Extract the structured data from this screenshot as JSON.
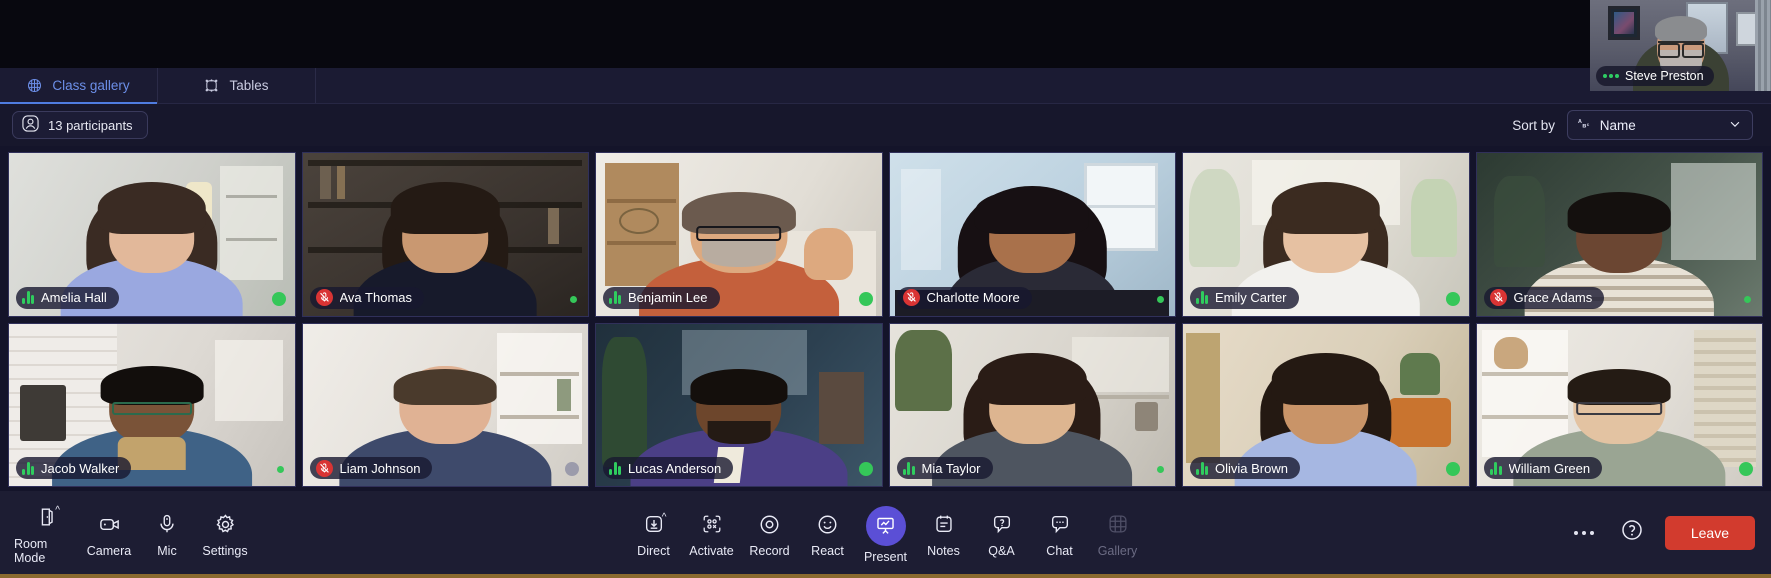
{
  "self_view": {
    "name": "Steve Preston",
    "indicator": "speaking-dots-icon",
    "indicator_color": "#2ecc63"
  },
  "tabs": [
    {
      "id": "class-gallery",
      "label": "Class gallery",
      "icon": "grid-globe-icon",
      "active": true
    },
    {
      "id": "tables",
      "label": "Tables",
      "icon": "table-seats-icon",
      "active": false
    }
  ],
  "header": {
    "participants_label": "13 participants",
    "participants_icon": "person-circle-icon",
    "sort_label": "Sort by",
    "sort_value": "Name",
    "sort_icon": "abc-sort-icon",
    "sort_chevron": "chevron-down-icon"
  },
  "colors": {
    "accent_blue": "#4f7ce0",
    "present_purple": "#5b4fd6",
    "leave_red": "#d23b2e",
    "mic_on_green": "#2fcc5e",
    "mic_off_red": "#d93434",
    "status_green": "#35c759",
    "status_grey": "#9b9bab"
  },
  "participants": [
    {
      "name": "Amelia Hall",
      "muted": false,
      "status": "green",
      "status_size": "large"
    },
    {
      "name": "Ava Thomas",
      "muted": true,
      "status": "green",
      "status_size": "small"
    },
    {
      "name": "Benjamin Lee",
      "muted": false,
      "status": "green",
      "status_size": "large"
    },
    {
      "name": "Charlotte Moore",
      "muted": true,
      "status": "green",
      "status_size": "small"
    },
    {
      "name": "Emily Carter",
      "muted": false,
      "status": "green",
      "status_size": "large"
    },
    {
      "name": "Grace Adams",
      "muted": true,
      "status": "green",
      "status_size": "small"
    },
    {
      "name": "Jacob Walker",
      "muted": false,
      "status": "green",
      "status_size": "small"
    },
    {
      "name": "Liam Johnson",
      "muted": true,
      "status": "grey",
      "status_size": "large"
    },
    {
      "name": "Lucas Anderson",
      "muted": false,
      "status": "green",
      "status_size": "large"
    },
    {
      "name": "Mia Taylor",
      "muted": false,
      "status": "green",
      "status_size": "small"
    },
    {
      "name": "Olivia Brown",
      "muted": false,
      "status": "green",
      "status_size": "large"
    },
    {
      "name": "William Green",
      "muted": false,
      "status": "green",
      "status_size": "large"
    }
  ],
  "toolbar": {
    "left": [
      {
        "id": "room-mode",
        "label": "Room Mode",
        "icon": "door-icon",
        "caret": "^"
      },
      {
        "id": "camera",
        "label": "Camera",
        "icon": "camera-icon",
        "caret": ""
      },
      {
        "id": "mic",
        "label": "Mic",
        "icon": "mic-icon",
        "caret": ""
      },
      {
        "id": "settings",
        "label": "Settings",
        "icon": "gear-icon",
        "caret": ""
      }
    ],
    "center": [
      {
        "id": "direct",
        "label": "Direct",
        "icon": "download-box-icon",
        "caret": "^",
        "active": false,
        "disabled": false
      },
      {
        "id": "activate",
        "label": "Activate",
        "icon": "qr-scan-icon",
        "caret": "",
        "active": false,
        "disabled": false
      },
      {
        "id": "record",
        "label": "Record",
        "icon": "record-circle-icon",
        "caret": "",
        "active": false,
        "disabled": false
      },
      {
        "id": "react",
        "label": "React",
        "icon": "smiley-icon",
        "caret": "",
        "active": false,
        "disabled": false
      },
      {
        "id": "present",
        "label": "Present",
        "icon": "presentation-icon",
        "caret": "",
        "active": true,
        "disabled": false
      },
      {
        "id": "notes",
        "label": "Notes",
        "icon": "notes-icon",
        "caret": "",
        "active": false,
        "disabled": false
      },
      {
        "id": "qa",
        "label": "Q&A",
        "icon": "question-bubble-icon",
        "caret": "",
        "active": false,
        "disabled": false
      },
      {
        "id": "chat",
        "label": "Chat",
        "icon": "chat-bubble-icon",
        "caret": "",
        "active": false,
        "disabled": false
      },
      {
        "id": "gallery",
        "label": "Gallery",
        "icon": "grid-icon",
        "caret": "",
        "active": false,
        "disabled": true
      }
    ],
    "right": {
      "more_icon": "more-horizontal-icon",
      "help_icon": "help-circle-icon",
      "leave_label": "Leave"
    }
  }
}
